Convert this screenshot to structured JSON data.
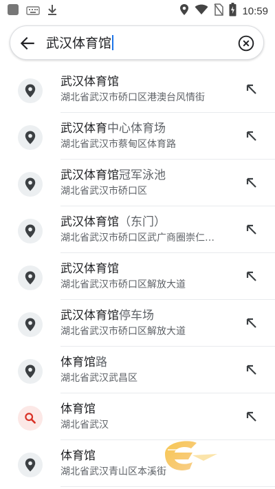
{
  "status_bar": {
    "time": "10:59",
    "icons": [
      "app-square-icon",
      "keyboard-icon",
      "download-icon",
      "location-icon",
      "wifi-icon",
      "no-sim-icon",
      "battery-charging-icon"
    ]
  },
  "search": {
    "query": "武汉体育馆",
    "back_icon": "arrow-left-icon",
    "clear_icon": "clear-circle-icon"
  },
  "results": [
    {
      "title_match": "武汉体育馆",
      "title_rest": "",
      "subtitle": "湖北省武汉市硚口区港澳台风情街",
      "icon": "place-pin-icon"
    },
    {
      "title_match": "武汉体育",
      "title_rest": "中心体育场",
      "subtitle": "湖北省武汉市蔡甸区体育路",
      "icon": "place-pin-icon"
    },
    {
      "title_match": "武汉体育馆",
      "title_rest": "冠军泳池",
      "subtitle": "湖北省武汉市硚口区",
      "icon": "place-pin-icon"
    },
    {
      "title_match": "武汉体育馆",
      "title_rest": "（东门）",
      "subtitle": "湖北省武汉市硚口区武广商圈崇仁…",
      "icon": "place-pin-icon"
    },
    {
      "title_match": "武汉体育馆",
      "title_rest": "",
      "subtitle": "湖北省武汉市硚口区解放大道",
      "icon": "place-pin-icon"
    },
    {
      "title_match": "武汉体育馆",
      "title_rest": "停车场",
      "subtitle": "湖北省武汉市硚口区解放大道",
      "icon": "place-pin-icon"
    },
    {
      "title_match": "体育馆",
      "title_rest": "路",
      "subtitle": "湖北省武汉武昌区",
      "icon": "place-pin-icon"
    },
    {
      "title_match": "体育馆",
      "title_rest": "",
      "subtitle": "湖北省武汉",
      "icon": "search-icon"
    },
    {
      "title_match": "体育馆",
      "title_rest": "",
      "subtitle": "湖北省武汉青山区本溪街",
      "icon": "place-pin-icon"
    }
  ],
  "colors": {
    "accent": "#1a73e8",
    "search_icon_red": "#d93025",
    "pin_gray": "#3c4043",
    "secondary_text": "#5f6368"
  }
}
